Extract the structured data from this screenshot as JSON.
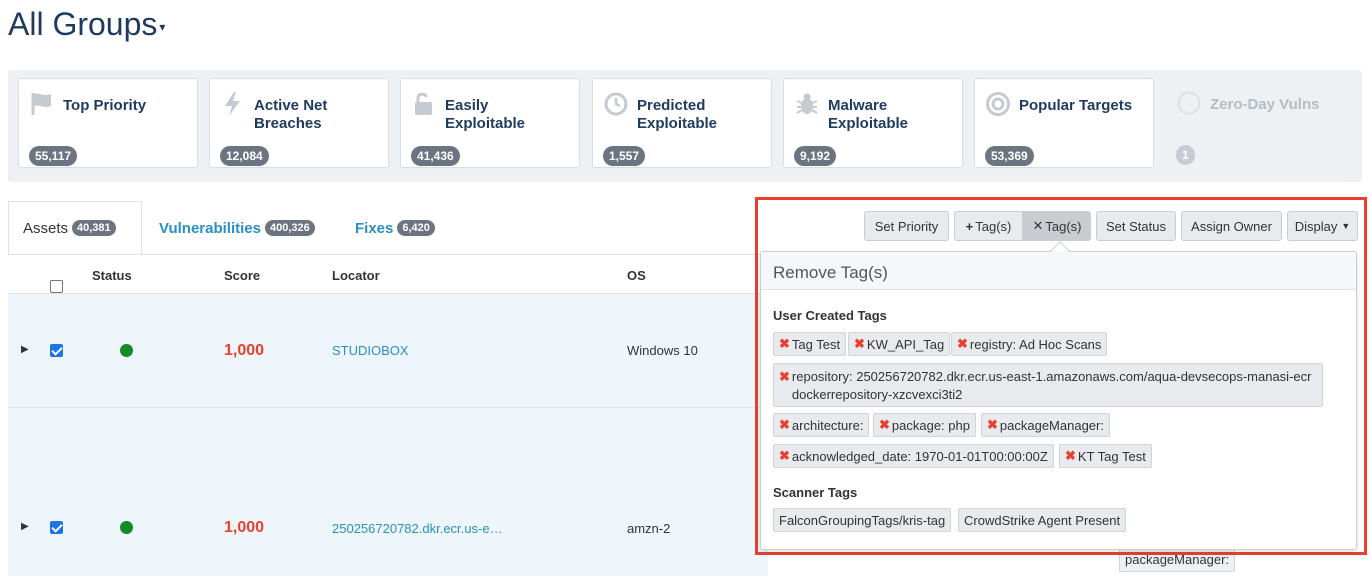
{
  "header": {
    "title": "All Groups"
  },
  "cards": [
    {
      "label": "Top Priority",
      "count": "55,117",
      "icon": "flag-icon"
    },
    {
      "label": "Active Net Breaches",
      "count": "12,084",
      "icon": "lightning-icon"
    },
    {
      "label": "Easily Exploitable",
      "count": "41,436",
      "icon": "unlock-icon"
    },
    {
      "label": "Predicted Exploitable",
      "count": "1,557",
      "icon": "clock-icon"
    },
    {
      "label": "Malware Exploitable",
      "count": "9,192",
      "icon": "bug-icon"
    },
    {
      "label": "Popular Targets",
      "count": "53,369",
      "icon": "target-icon"
    },
    {
      "label": "Zero-Day Vulns",
      "count": "1",
      "icon": "circle-icon"
    }
  ],
  "tabs": [
    {
      "label": "Assets",
      "count": "40,381"
    },
    {
      "label": "Vulnerabilities",
      "count": "400,326"
    },
    {
      "label": "Fixes",
      "count": "6,420"
    }
  ],
  "columns": {
    "status": "Status",
    "score": "Score",
    "locator": "Locator",
    "os": "OS"
  },
  "rows": [
    {
      "score": "1,000",
      "locator": "STUDIOBOX",
      "os": "Windows 10",
      "status_color": "#148a2b"
    },
    {
      "score": "1,000",
      "locator": "250256720782.dkr.ecr.us-e…",
      "os": "amzn-2",
      "status_color": "#148a2b"
    }
  ],
  "toolbar": {
    "set_priority": "Set Priority",
    "add_tags": "Tag(s)",
    "remove_tags": "Tag(s)",
    "set_status": "Set Status",
    "assign_owner": "Assign Owner",
    "display": "Display"
  },
  "popover": {
    "title": "Remove Tag(s)",
    "user_section": "User Created Tags",
    "user_tags": [
      "Tag Test",
      "KW_API_Tag",
      "registry: Ad Hoc Scans",
      "repository: 250256720782.dkr.ecr.us-east-1.amazonaws.com/aqua-devsecops-manasi-ecrdockerrepository-xzcvexci3ti2",
      "architecture:",
      "package: php",
      "packageManager:",
      "acknowledged_date: 1970-01-01T00:00:00Z",
      "KT Tag Test"
    ],
    "scanner_section": "Scanner Tags",
    "scanner_tags": [
      "FalconGroupingTags/kris-tag",
      "CrowdStrike Agent Present"
    ]
  },
  "background_tag": "packageManager:",
  "colors": {
    "accent_red": "#e8402f",
    "link_blue": "#2a8fc4",
    "title_navy": "#1f3a5f",
    "status_green": "#148a2b"
  }
}
